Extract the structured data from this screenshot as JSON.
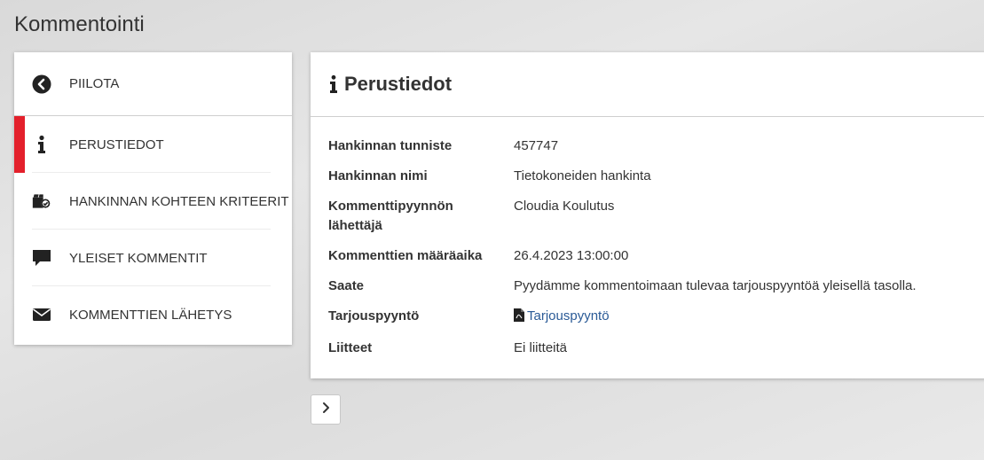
{
  "page": {
    "title": "Kommentointi"
  },
  "sidebar": {
    "items": [
      {
        "label": "PIILOTA",
        "icon": "chevron-circle-left-icon"
      },
      {
        "label": "PERUSTIEDOT",
        "icon": "info-icon",
        "active": true
      },
      {
        "label": "HANKINNAN KOHTEEN KRITEERIT",
        "icon": "box-check-icon"
      },
      {
        "label": "YLEISET KOMMENTIT",
        "icon": "comment-icon"
      },
      {
        "label": "KOMMENTTIEN LÄHETYS",
        "icon": "envelope-icon"
      }
    ]
  },
  "main": {
    "title": "Perustiedot",
    "rows": [
      {
        "key": "Hankinnan tunniste",
        "value": "457747"
      },
      {
        "key": "Hankinnan nimi",
        "value": "Tietokoneiden hankinta"
      },
      {
        "key": "Kommenttipyynnön lähettäjä",
        "value": "Cloudia Koulutus"
      },
      {
        "key": "Kommenttien määräaika",
        "value": "26.4.2023 13:00:00"
      },
      {
        "key": "Saate",
        "value": "Pyydämme kommentoimaan tulevaa tarjouspyyntöä yleisellä tasolla."
      },
      {
        "key": "Tarjouspyyntö",
        "value": "Tarjouspyyntö",
        "icon": "file-pdf-icon"
      },
      {
        "key": "Liitteet",
        "value": "Ei liitteitä"
      }
    ]
  },
  "colors": {
    "accent": "#e3202b",
    "link": "#2a5a96"
  }
}
